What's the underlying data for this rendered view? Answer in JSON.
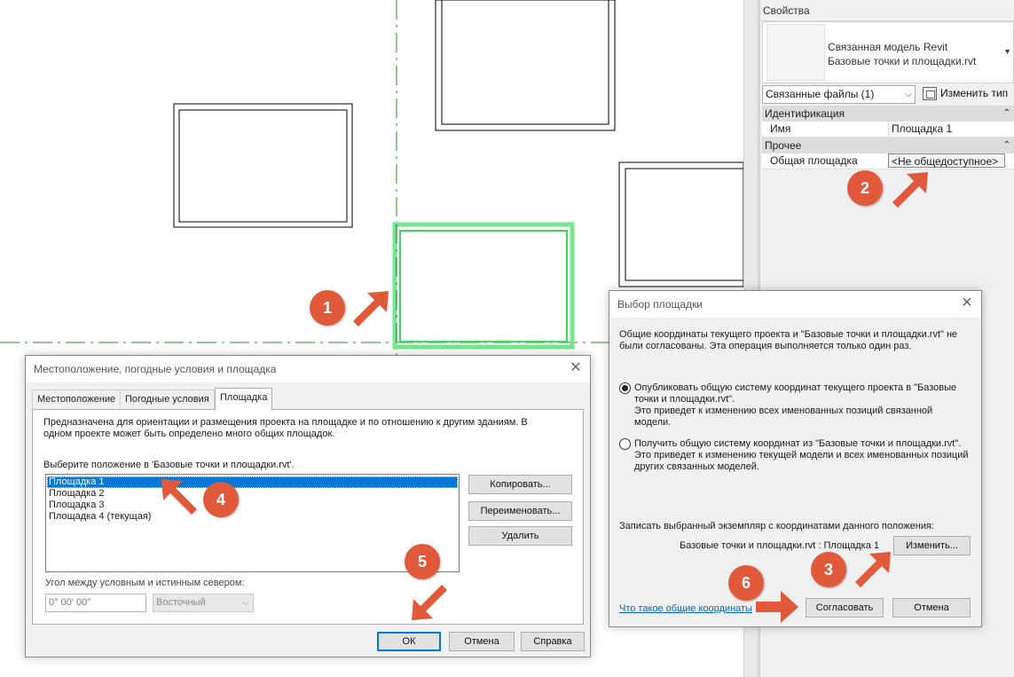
{
  "canvas": {
    "menu_glyph": "▾"
  },
  "properties": {
    "title": "Свойства",
    "type_line1": "Связанная модель Revit",
    "type_line2": "Базовые точки и площадки.rvt",
    "filter": "Связанные файлы (1)",
    "edit_type": "Изменить тип",
    "groups": [
      {
        "name": "Идентификация",
        "rows": [
          {
            "key": "Имя",
            "value": "Площадка 1"
          }
        ]
      },
      {
        "name": "Прочее",
        "rows": [
          {
            "key": "Общая площадка",
            "value": "<Не общедоступное>"
          }
        ]
      }
    ]
  },
  "dialog_location": {
    "title": "Местоположение, погодные условия и площадка",
    "tabs": [
      "Местоположение",
      "Погодные условия",
      "Площадка"
    ],
    "description": "Предназначена для ориентации и размещения проекта на площадке и по отношению к другим зданиям. В одном проекте может быть определено много общих площадок.",
    "select_label": "Выберите положение в 'Базовые точки и площадки.rvt'.",
    "sites": [
      "Площадка 1",
      "Площадка 2",
      "Площадка 3",
      "Площадка 4 (текущая)"
    ],
    "buttons": {
      "copy": "Копировать...",
      "rename": "Переименовать...",
      "delete": "Удалить"
    },
    "angle_label": "Угол между условным и истинным севером:",
    "angle_value": "0° 00' 00\"",
    "direction_value": "Восточный",
    "ok": "ОК",
    "cancel": "Отмена",
    "help": "Справка"
  },
  "dialog_site": {
    "title": "Выбор площадки",
    "intro": "Общие координаты текущего проекта и \"Базовые точки и площадки.rvt\" не были согласованы. Эта операция выполняется только один раз.",
    "option1": "Опубликовать общую систему координат текущего проекта в \"Базовые точки и площадки.rvt\".",
    "option1_note": "Это приведет к изменению всех именованных позиций связанной модели.",
    "option2": "Получить общую систему координат из \"Базовые точки и площадки.rvt\".",
    "option2_note": "Это приведет к изменению текущей модели и всех именованных позиций других связанных моделей.",
    "record_label": "Записать выбранный экземпляр с координатами данного положения:",
    "record_value": "Базовые точки и площадки.rvt : Площадка 1",
    "change": "Изменить...",
    "link": "Что такое общие координаты",
    "agree": "Согласовать",
    "cancel": "Отмена"
  },
  "callouts": [
    "1",
    "2",
    "3",
    "4",
    "5",
    "6"
  ],
  "colors": {
    "accent": "#e0593a",
    "selection": "#0078d7",
    "highlight_green": "#3ddc5a"
  }
}
